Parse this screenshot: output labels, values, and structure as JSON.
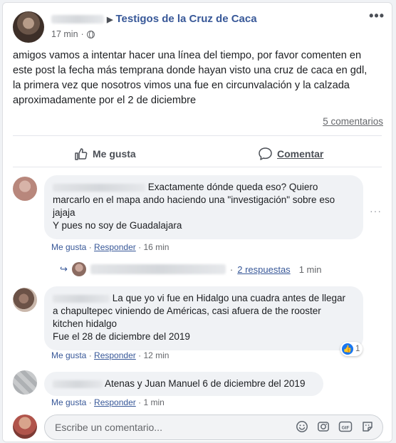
{
  "post": {
    "group_name": "Testigos de la Cruz de Caca",
    "time": "17 min",
    "text_lines": [
      "amigos vamos a intentar hacer una línea del tiempo, por favor comenten en",
      "este post la fecha más temprana donde hayan visto una cruz de caca en gdl,",
      "la primera vez que nosotros vimos una fue en circunvalación y la calzada",
      "aproximadamente por el 2 de diciembre"
    ],
    "comments_count": "5 comentarios"
  },
  "actions": {
    "like": "Me gusta",
    "comment": "Comentar"
  },
  "comments": [
    {
      "text_lines": [
        "Exactamente dónde queda eso? Quiero",
        "marcarlo en el mapa ando haciendo una \"investigación\" sobre eso",
        "jajaja",
        "Y pues no soy de Guadalajara"
      ],
      "like": "Me gusta",
      "reply": "Responder",
      "time": "16 min",
      "replies_link": "2 respuestas",
      "replies_time": "1 min"
    },
    {
      "text_lines": [
        "La que yo vi fue en Hidalgo una cuadra antes de llegar",
        "a chapultepec viniendo de Américas, casi afuera de the rooster",
        "kitchen hidalgo",
        "Fue el 28 de diciembre del 2019"
      ],
      "like": "Me gusta",
      "reply": "Responder",
      "time": "12 min",
      "reaction_count": "1"
    },
    {
      "text_lines": [
        "Atenas y Juan Manuel 6 de diciembre del 2019"
      ],
      "like": "Me gusta",
      "reply": "Responder",
      "time": "1 min"
    }
  ],
  "separator": "·",
  "write_comment": {
    "placeholder": "Escribe un comentario..."
  },
  "icons": {
    "more": "more-horizontal-icon",
    "globe": "globe-icon",
    "like": "thumbs-up-icon",
    "comment": "comment-bubble-icon",
    "emoji": "emoji-icon",
    "camera": "camera-icon",
    "gif": "gif-icon",
    "sticker": "sticker-icon",
    "reply_arrow": "reply-arrow-icon"
  },
  "colors": {
    "link": "#385898",
    "like_blue": "#1877f2",
    "text": "#1c1e21",
    "meta": "#65676b"
  }
}
